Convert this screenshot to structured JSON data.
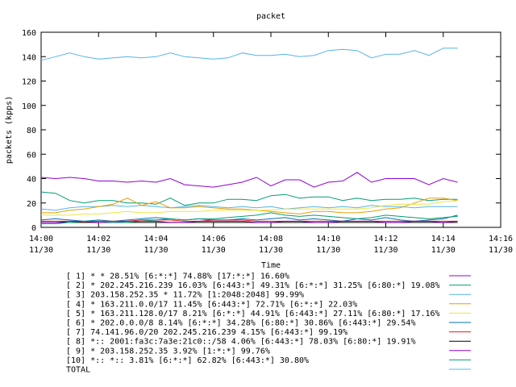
{
  "chart_data": {
    "type": "line",
    "title": "packet",
    "xlabel": "Time",
    "ylabel": "packets (kpps)",
    "ylim": [
      0,
      160
    ],
    "yticks": [
      "0",
      "20",
      "40",
      "60",
      "80",
      "100",
      "120",
      "140",
      "160"
    ],
    "xlim_minutes": [
      0,
      16
    ],
    "xticks": [
      {
        "time": "14:00",
        "date": "11/30"
      },
      {
        "time": "14:02",
        "date": "11/30"
      },
      {
        "time": "14:04",
        "date": "11/30"
      },
      {
        "time": "14:06",
        "date": "11/30"
      },
      {
        "time": "14:08",
        "date": "11/30"
      },
      {
        "time": "14:10",
        "date": "11/30"
      },
      {
        "time": "14:12",
        "date": "11/30"
      },
      {
        "time": "14:14",
        "date": "11/30"
      },
      {
        "time": "14:16",
        "date": "11/30"
      }
    ],
    "x_minutes": [
      0,
      0.5,
      1,
      1.5,
      2,
      2.5,
      3,
      3.5,
      4,
      4.5,
      5,
      5.5,
      6,
      6.5,
      7,
      7.5,
      8,
      8.5,
      9,
      9.5,
      10,
      10.5,
      11,
      11.5,
      12,
      12.5,
      13,
      13.5,
      14,
      14.5
    ],
    "legend_placement": "bottom",
    "series": [
      {
        "name": "[ 1] * * 28.51%  [6:*:*] 74.88% [17:*:*] 16.60%",
        "color": "#9400d3",
        "values": [
          41,
          40,
          41,
          40,
          38,
          38,
          37,
          38,
          37,
          40,
          35,
          34,
          33,
          35,
          37,
          41,
          34,
          39,
          39,
          33,
          37,
          38,
          45,
          37,
          40,
          40,
          40,
          35,
          40,
          37
        ]
      },
      {
        "name": "[ 2] * 202.245.216.239 16.03%  [6:443:*] 49.31% [6:*:*] 31.25% [6:80:*] 19.08%",
        "color": "#009e73",
        "values": [
          29,
          28,
          22,
          20,
          22,
          22,
          20,
          20,
          19,
          24,
          18,
          20,
          20,
          23,
          23,
          22,
          26,
          27,
          24,
          25,
          25,
          22,
          24,
          22,
          23,
          23,
          24,
          22,
          23,
          23
        ]
      },
      {
        "name": "[ 3] 203.158.252.35 * 11.72%  [1:2048:2048] 99.99%",
        "color": "#56b4e9",
        "values": [
          15,
          14,
          16,
          17,
          17,
          18,
          17,
          18,
          17,
          16,
          17,
          18,
          17,
          16,
          17,
          16,
          17,
          15,
          16,
          17,
          16,
          17,
          16,
          18,
          17,
          17,
          16,
          17,
          17,
          17
        ]
      },
      {
        "name": "[ 4] * 163.211.0.0/17 11.45%  [6:443:*] 72.71% [6:*:*] 22.03%",
        "color": "#e69f00",
        "values": [
          12,
          12,
          14,
          15,
          17,
          19,
          24,
          18,
          21,
          16,
          16,
          17,
          16,
          15,
          15,
          14,
          13,
          12,
          11,
          13,
          13,
          12,
          12,
          13,
          15,
          16,
          20,
          24,
          24,
          22
        ]
      },
      {
        "name": "[ 5] * 163.211.128.0/17 8.21%  [6:*:*] 44.91% [6:443:*] 27.11% [6:80:*] 17.16%",
        "color": "#f0e442",
        "values": [
          10,
          10,
          10,
          11,
          11,
          12,
          13,
          12,
          12,
          13,
          13,
          13,
          14,
          14,
          14,
          14,
          14,
          15,
          15,
          15,
          15,
          15,
          15,
          16,
          18,
          19,
          19,
          19,
          21,
          22
        ]
      },
      {
        "name": "[ 6] * 202.0.0.0/8 8.14%  [6:*:*] 34.28% [6:80:*] 30.86% [6:443:*] 29.54%",
        "color": "#0072b2",
        "values": [
          6,
          7,
          6,
          5,
          6,
          5,
          6,
          7,
          8,
          7,
          6,
          7,
          6,
          6,
          7,
          6,
          7,
          8,
          6,
          7,
          6,
          5,
          7,
          6,
          8,
          6,
          5,
          6,
          7,
          10
        ]
      },
      {
        "name": "[ 7] 74.141.96.0/20 202.245.216.239 4.15%  [6:443:*] 99.19%",
        "color": "#e51e10",
        "values": [
          5,
          5,
          5,
          4,
          5,
          5,
          5,
          6,
          6,
          6,
          5,
          5,
          6,
          6,
          6,
          5,
          5,
          5,
          5,
          5,
          5,
          5,
          5,
          5,
          5,
          5,
          5,
          5,
          5,
          5
        ]
      },
      {
        "name": "[ 8] *:: 2001:fa3c:7a3e:21c0::/58 4.06%  [6:443:*] 78.03% [6:80:*] 19.91%",
        "color": "#000000",
        "values": [
          4,
          4,
          4,
          4,
          4,
          4,
          4,
          4,
          4,
          4,
          4,
          4,
          4,
          4,
          4,
          4,
          4,
          4,
          4,
          4,
          4,
          4,
          4,
          4,
          4,
          4,
          4,
          4,
          4,
          4
        ]
      },
      {
        "name": "[ 9] * 203.158.252.35 3.92%  [1:*:*] 99.76%",
        "color": "#9400d3",
        "values": [
          4,
          4,
          5,
          5,
          4,
          4,
          5,
          5,
          5,
          4,
          4,
          5,
          5,
          5,
          5,
          4,
          4,
          5,
          5,
          4,
          4,
          5,
          5,
          5,
          4,
          4,
          5,
          5,
          4,
          5
        ]
      },
      {
        "name": "[10] *:: *:: 3.81%  [6:*:*] 62.82% [6:443:*] 30.80%",
        "color": "#009e73",
        "values": [
          3,
          3,
          4,
          5,
          5,
          4,
          4,
          5,
          6,
          7,
          6,
          7,
          7,
          8,
          9,
          10,
          12,
          10,
          9,
          10,
          9,
          8,
          7,
          8,
          10,
          9,
          8,
          7,
          8,
          9
        ]
      },
      {
        "name": "TOTAL",
        "color": "#56b4e9",
        "values": [
          137,
          140,
          143,
          140,
          138,
          139,
          140,
          139,
          140,
          143,
          140,
          139,
          138,
          139,
          143,
          141,
          141,
          142,
          140,
          141,
          145,
          146,
          145,
          139,
          142,
          142,
          145,
          141,
          147,
          147
        ]
      }
    ]
  }
}
